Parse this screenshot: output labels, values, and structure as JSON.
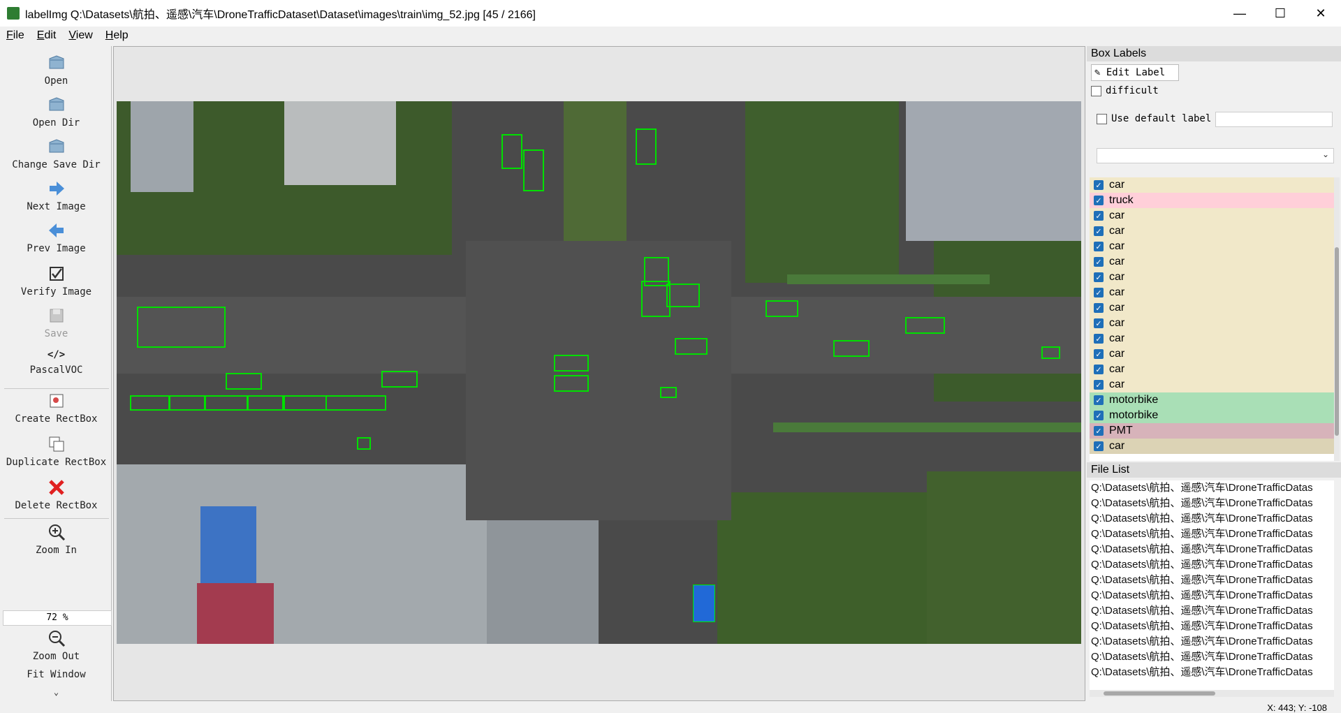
{
  "window": {
    "title": "labelImg Q:\\Datasets\\航拍、遥感\\汽车\\DroneTrafficDataset\\Dataset\\images\\train\\img_52.jpg [45 / 2166]",
    "minimize": "—",
    "maximize": "☐",
    "close": "✕"
  },
  "menu": [
    "File",
    "Edit",
    "View",
    "Help"
  ],
  "toolbar": {
    "open": "Open",
    "open_dir": "Open Dir",
    "change_save_dir": "Change Save Dir",
    "next_image": "Next Image",
    "prev_image": "Prev Image",
    "verify_image": "Verify Image",
    "save": "Save",
    "format_icon": "</>",
    "format": "PascalVOC",
    "create_rectbox": "Create RectBox",
    "duplicate_rectbox": "Duplicate RectBox",
    "delete_rectbox": "Delete RectBox",
    "zoom_in": "Zoom In",
    "zoom_value": "72 %",
    "zoom_out": "Zoom Out",
    "fit_window": "Fit Window",
    "more": "⌄"
  },
  "box_labels": {
    "title": "Box Labels",
    "edit_label": "Edit Label",
    "difficult": "difficult",
    "use_default_label": "Use default label",
    "default_label_value": "",
    "combo_value": "",
    "items": [
      {
        "label": "car",
        "color": "#f1e8c9"
      },
      {
        "label": "truck",
        "color": "#ffcfd9"
      },
      {
        "label": "car",
        "color": "#f1e8c9"
      },
      {
        "label": "car",
        "color": "#f1e8c9"
      },
      {
        "label": "car",
        "color": "#f1e8c9"
      },
      {
        "label": "car",
        "color": "#f1e8c9"
      },
      {
        "label": "car",
        "color": "#f1e8c9"
      },
      {
        "label": "car",
        "color": "#f1e8c9"
      },
      {
        "label": "car",
        "color": "#f1e8c9"
      },
      {
        "label": "car",
        "color": "#f1e8c9"
      },
      {
        "label": "car",
        "color": "#f1e8c9"
      },
      {
        "label": "car",
        "color": "#f1e8c9"
      },
      {
        "label": "car",
        "color": "#f1e8c9"
      },
      {
        "label": "car",
        "color": "#f1e8c9"
      },
      {
        "label": "motorbike",
        "color": "#a9dfb6"
      },
      {
        "label": "motorbike",
        "color": "#a9dfb6"
      },
      {
        "label": "PMT",
        "color": "#d7b3ba"
      },
      {
        "label": "car",
        "color": "#dcd3b5"
      }
    ]
  },
  "file_list": {
    "title": "File List",
    "items": [
      "Q:\\Datasets\\航拍、遥感\\汽车\\DroneTrafficDatas",
      "Q:\\Datasets\\航拍、遥感\\汽车\\DroneTrafficDatas",
      "Q:\\Datasets\\航拍、遥感\\汽车\\DroneTrafficDatas",
      "Q:\\Datasets\\航拍、遥感\\汽车\\DroneTrafficDatas",
      "Q:\\Datasets\\航拍、遥感\\汽车\\DroneTrafficDatas",
      "Q:\\Datasets\\航拍、遥感\\汽车\\DroneTrafficDatas",
      "Q:\\Datasets\\航拍、遥感\\汽车\\DroneTrafficDatas",
      "Q:\\Datasets\\航拍、遥感\\汽车\\DroneTrafficDatas",
      "Q:\\Datasets\\航拍、遥感\\汽车\\DroneTrafficDatas",
      "Q:\\Datasets\\航拍、遥感\\汽车\\DroneTrafficDatas",
      "Q:\\Datasets\\航拍、遥感\\汽车\\DroneTrafficDatas",
      "Q:\\Datasets\\航拍、遥感\\汽车\\DroneTrafficDatas",
      "Q:\\Datasets\\航拍、遥感\\汽车\\DroneTrafficDatas"
    ]
  },
  "status": {
    "coords": "X: 443; Y: -108"
  }
}
